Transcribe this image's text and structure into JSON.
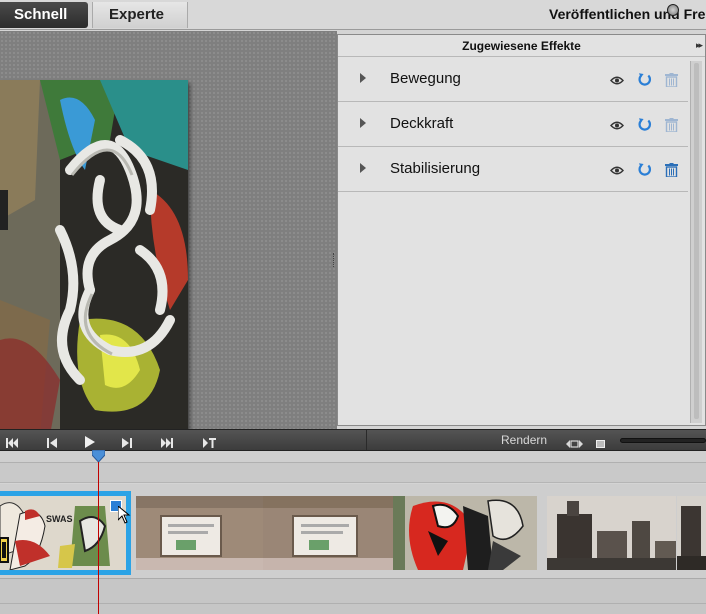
{
  "header": {
    "tabs": [
      {
        "label": "Schnell",
        "active": true
      },
      {
        "label": "Experte",
        "active": false
      }
    ],
    "publish_label": "Veröffentlichen und Frei"
  },
  "effects_panel": {
    "title": "Zugewiesene Effekte",
    "items": [
      {
        "label": "Bewegung",
        "icons": [
          "eye-icon",
          "reset-icon",
          "trash-icon"
        ]
      },
      {
        "label": "Deckkraft",
        "icons": [
          "eye-icon",
          "reset-icon",
          "trash-icon"
        ]
      },
      {
        "label": "Stabilisierung",
        "icons": [
          "eye-icon",
          "reset-icon",
          "trash-icon"
        ]
      }
    ]
  },
  "transport": {
    "buttons": [
      "go-to-start-icon",
      "step-back-icon",
      "play-icon",
      "step-forward-icon",
      "go-to-end-icon",
      "split-clip-icon"
    ],
    "render_label": "Rendern"
  },
  "colors": {
    "accent": "#2ba3e6",
    "playhead": "#c00000",
    "icon_blue": "#2b7fd6"
  }
}
